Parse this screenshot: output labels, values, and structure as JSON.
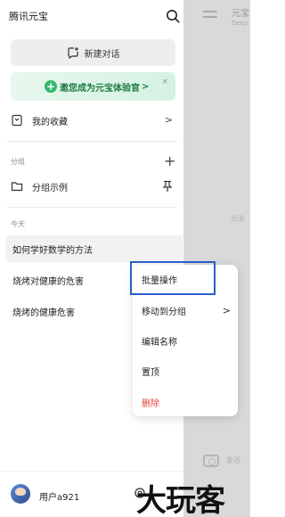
{
  "header": {
    "title": "腾讯元宝"
  },
  "new_chat": {
    "label": "新建对话"
  },
  "banner": {
    "label": "邀您成为元宝体验官",
    "arrow": ">",
    "close": "×"
  },
  "favorites": {
    "label": "我的收藏",
    "arrow": ">"
  },
  "groups": {
    "section": "分组",
    "add": "+",
    "example": "分组示例"
  },
  "today": {
    "section": "今天",
    "chats": [
      "如何学好数学的方法",
      "烧烤对健康的危害",
      "烧烤的健康危害"
    ]
  },
  "context_menu": {
    "items": [
      "批量操作",
      "移动到分组",
      "编辑名称",
      "置顶",
      "删除"
    ],
    "submenu_arrow": ">"
  },
  "user": {
    "name": "用户a921"
  },
  "behind": {
    "title": "元宝",
    "subtitle": "Deep",
    "ghost": "元未",
    "camera_text": "发送"
  },
  "watermark": "大玩客",
  "colors": {
    "accent_green": "#33b86a",
    "danger": "#e2433f",
    "highlight": "#2c5fc9"
  }
}
